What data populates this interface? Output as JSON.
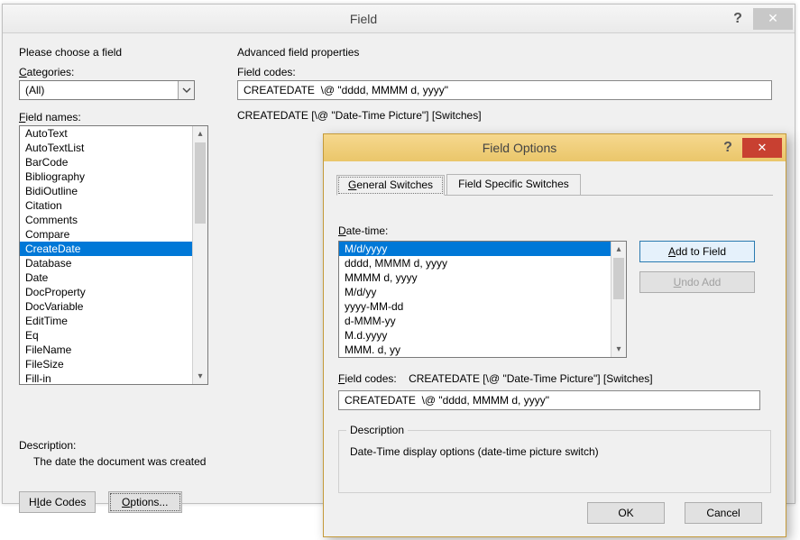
{
  "field_dialog": {
    "title": "Field",
    "choose_label": "Please choose a field",
    "categories_label": "Categories:",
    "categories_underline": "C",
    "category_selected": "(All)",
    "fieldnames_label": "Field names:",
    "fieldnames_underline": "F",
    "field_names": [
      "AutoText",
      "AutoTextList",
      "BarCode",
      "Bibliography",
      "BidiOutline",
      "Citation",
      "Comments",
      "Compare",
      "CreateDate",
      "Database",
      "Date",
      "DocProperty",
      "DocVariable",
      "EditTime",
      "Eq",
      "FileName",
      "FileSize",
      "Fill-in"
    ],
    "selected_field_index": 8,
    "adv_label": "Advanced field properties",
    "fieldcodes_label": "Field codes:",
    "fieldcodes_value": "CREATEDATE  \\@ \"dddd, MMMM d, yyyy\"",
    "syntax_text": "CREATEDATE [\\@ \"Date-Time Picture\"] [Switches]",
    "description_label": "Description:",
    "description_text": "The date the document was created",
    "hide_codes_label": "Hide Codes",
    "hide_codes_underline": "I",
    "options_label": "Options...",
    "options_underline": "O"
  },
  "options_dialog": {
    "title": "Field Options",
    "tab_general": "General Switches",
    "tab_general_underline": "G",
    "tab_specific": "Field Specific Switches",
    "datetime_label": "Date-time:",
    "datetime_underline": "D",
    "datetime_items": [
      "M/d/yyyy",
      "dddd, MMMM d, yyyy",
      "MMMM d, yyyy",
      "M/d/yy",
      "yyyy-MM-dd",
      "d-MMM-yy",
      "M.d.yyyy",
      "MMM. d, yy"
    ],
    "selected_dt_index": 0,
    "add_to_field": "Add to Field",
    "add_to_field_underline": "A",
    "undo_add": "Undo Add",
    "undo_add_underline": "U",
    "fieldcodes_label": "Field codes:",
    "fieldcodes_underline": "F",
    "syntax_text": "CREATEDATE [\\@ \"Date-Time Picture\"] [Switches]",
    "fieldcodes_value": "CREATEDATE  \\@ \"dddd, MMMM d, yyyy\"",
    "description_label": "Description",
    "description_text": "Date-Time display options (date-time picture switch)",
    "ok": "OK",
    "cancel": "Cancel"
  }
}
